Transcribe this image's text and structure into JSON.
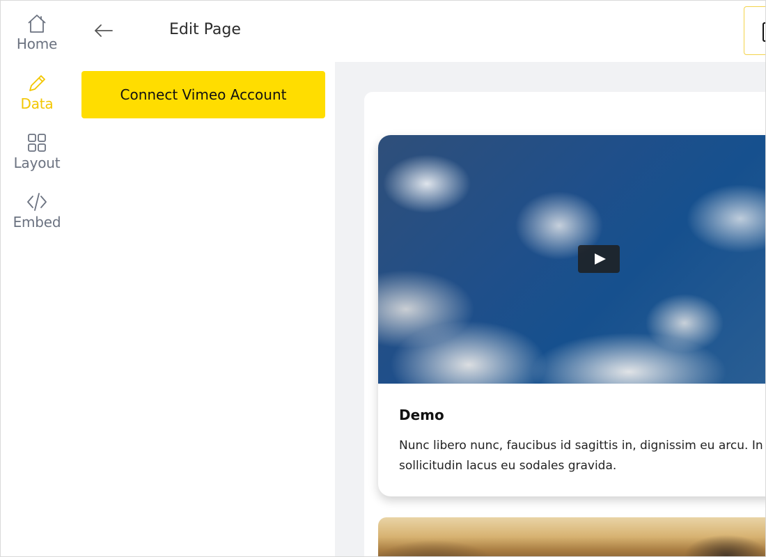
{
  "nav": {
    "items": [
      {
        "label": "Home",
        "icon": "home-icon",
        "active": false
      },
      {
        "label": "Data",
        "icon": "pencil-icon",
        "active": true
      },
      {
        "label": "Layout",
        "icon": "grid-icon",
        "active": false
      },
      {
        "label": "Embed",
        "icon": "code-icon",
        "active": false
      }
    ],
    "active_color": "#f3c600",
    "inactive_color": "#6b7280"
  },
  "header": {
    "title": "Edit Page",
    "back_icon": "arrow-left-icon"
  },
  "sidebar": {
    "connect_label": "Connect Vimeo Account",
    "button_color": "#ffdd00"
  },
  "preview": {
    "cards": [
      {
        "title": "Demo",
        "description_line1": "Nunc libero nunc, faucibus id sagittis in, dignissim eu arcu. In",
        "description_line2": "sollicitudin lacus eu sodales gravida.",
        "has_video": true
      }
    ]
  }
}
